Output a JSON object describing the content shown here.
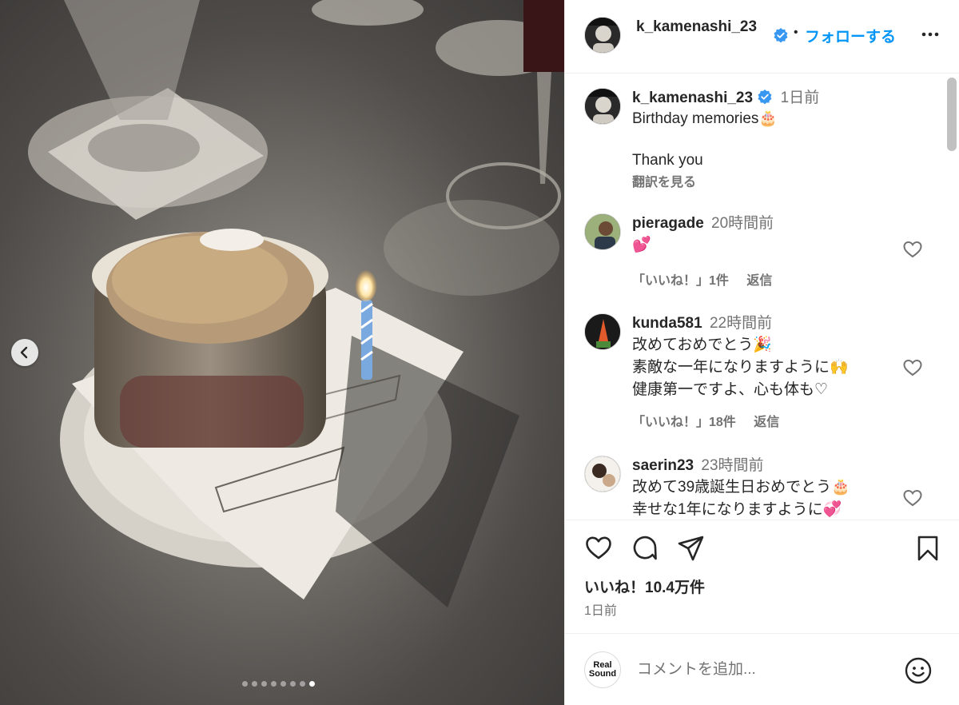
{
  "post_author": {
    "username": "k_kamenashi_23",
    "verified": true,
    "follow_label": "フォローする",
    "separator": "•"
  },
  "carousel": {
    "slide_count": 8,
    "active_slide_index": 7,
    "image_description_icons": [
      "chevron-left-icon"
    ]
  },
  "caption": {
    "username": "k_kamenashi_23",
    "time": "1日前",
    "text": "Birthday memories🎂\n\nThank you",
    "translate_label": "翻訳を見る"
  },
  "comments": [
    {
      "username": "pieragade",
      "time": "20時間前",
      "text": "💕",
      "likes_label": "「いいね！」1件",
      "reply_label": "返信"
    },
    {
      "username": "kunda581",
      "time": "22時間前",
      "text": "改めておめでとう🎉\n素敵な一年になりますように🙌\n健康第一ですよ、心も体も♡",
      "likes_label": "「いいね！」18件",
      "reply_label": "返信"
    },
    {
      "username": "saerin23",
      "time": "23時間前",
      "text": "改めて39歳誕生日おめでとう🎂\n幸せな1年になりますように💞",
      "likes_label": "",
      "reply_label": ""
    }
  ],
  "post_stats": {
    "likes": "いいね！10.4万件",
    "date": "1日前"
  },
  "composer": {
    "logo_line1": "Real",
    "logo_line2": "Sound",
    "placeholder": "コメントを追加..."
  },
  "colors": {
    "accent": "#0095f6",
    "verified": "#3897f0",
    "muted": "#737373",
    "text": "#262626"
  }
}
